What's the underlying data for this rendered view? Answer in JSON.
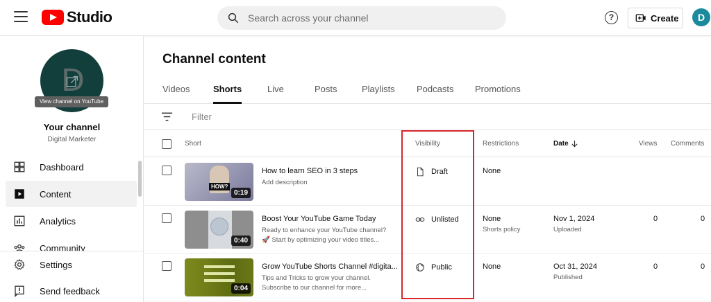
{
  "header": {
    "logo_text": "Studio",
    "search_placeholder": "Search across your channel",
    "help_label": "?",
    "create_label": "Create",
    "avatar_letter": "D"
  },
  "sidebar": {
    "channel_avatar_letter": "D",
    "view_channel_label": "View channel on YouTube",
    "channel_title": "Your channel",
    "channel_subtitle": "Digital Marketer",
    "nav": [
      {
        "label": "Dashboard",
        "icon": "dashboard-icon"
      },
      {
        "label": "Content",
        "icon": "content-icon",
        "active": true
      },
      {
        "label": "Analytics",
        "icon": "analytics-icon"
      },
      {
        "label": "Community",
        "icon": "community-icon"
      }
    ],
    "bottom_nav": [
      {
        "label": "Settings",
        "icon": "gear-icon"
      },
      {
        "label": "Send feedback",
        "icon": "feedback-icon"
      }
    ]
  },
  "main": {
    "title": "Channel content",
    "tabs": [
      "Videos",
      "Shorts",
      "Live",
      "Posts",
      "Playlists",
      "Podcasts",
      "Promotions"
    ],
    "active_tab": "Shorts",
    "filter_placeholder": "Filter",
    "columns": {
      "short": "Short",
      "visibility": "Visibility",
      "restrictions": "Restrictions",
      "date": "Date",
      "views": "Views",
      "comments": "Comments"
    },
    "rows": [
      {
        "title": "How to learn SEO in 3 steps",
        "desc1": "Add description",
        "desc2": "",
        "duration": "0:19",
        "visibility": "Draft",
        "restrictions": "None",
        "restrictions_sub": "",
        "date": "",
        "date_sub": "",
        "views": "",
        "comments": "",
        "thumb_text": "HOW?"
      },
      {
        "title": "Boost Your YouTube Game Today",
        "desc1": "Ready to enhance your YouTube channel?",
        "desc2": "🚀 Start by optimizing your video titles...",
        "duration": "0:40",
        "visibility": "Unlisted",
        "restrictions": "None",
        "restrictions_sub": "Shorts policy",
        "date": "Nov 1, 2024",
        "date_sub": "Uploaded",
        "views": "0",
        "comments": "0"
      },
      {
        "title": "Grow YouTube Shorts Channel #digita...",
        "desc1": "Tips and Tricks to grow your channel.",
        "desc2": "Subscribe to our channel for more...",
        "duration": "0:04",
        "visibility": "Public",
        "restrictions": "None",
        "restrictions_sub": "",
        "date": "Oct 31, 2024",
        "date_sub": "Published",
        "views": "0",
        "comments": "0"
      }
    ]
  },
  "colors": {
    "brand_red": "#ff0000",
    "highlight": "#d6262a",
    "avatar_teal": "#1a8a9c"
  }
}
